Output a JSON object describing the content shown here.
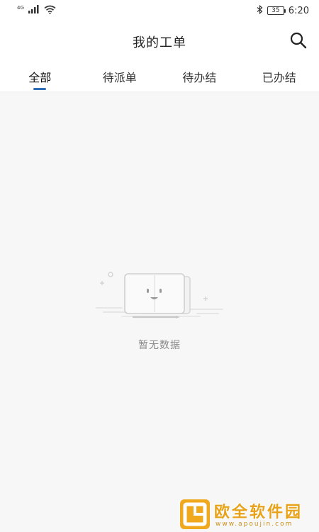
{
  "status_bar": {
    "network": "4G",
    "time": "6:20",
    "battery": "35"
  },
  "header": {
    "title": "我的工单"
  },
  "tabs": [
    {
      "label": "全部",
      "active": true
    },
    {
      "label": "待派单",
      "active": false
    },
    {
      "label": "待办结",
      "active": false
    },
    {
      "label": "已办结",
      "active": false
    }
  ],
  "empty_state": {
    "text": "暂无数据"
  },
  "watermark": {
    "brand": "欧全软件园",
    "url": "www.apoujin.com"
  },
  "colors": {
    "accent": "#2d6fb5",
    "background": "#f7f7f7",
    "header_bg": "#ffffff",
    "watermark": "#e8a21a"
  },
  "icons": {
    "search": "search-icon",
    "signal": "signal-icon",
    "wifi": "wifi-icon",
    "bluetooth": "bluetooth-icon",
    "battery": "battery-icon"
  }
}
